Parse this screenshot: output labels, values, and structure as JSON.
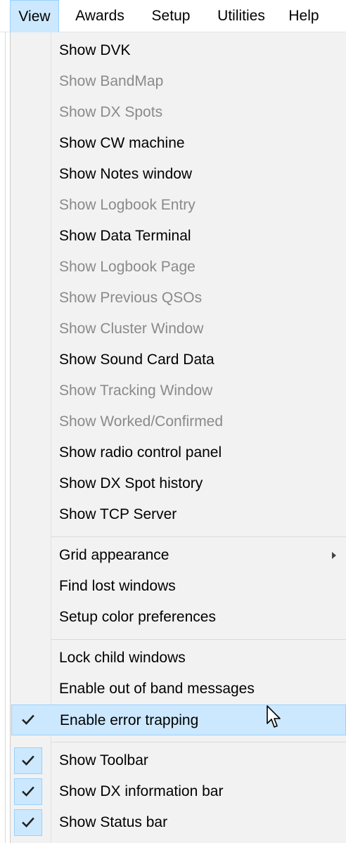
{
  "menubar": {
    "items": [
      {
        "label": "View",
        "active": true
      },
      {
        "label": "Awards",
        "active": false
      },
      {
        "label": "Setup",
        "active": false
      },
      {
        "label": "Utilities",
        "active": false
      },
      {
        "label": "Help",
        "active": false
      }
    ]
  },
  "view_menu": {
    "items": [
      {
        "label": "Show DVK",
        "enabled": true,
        "checked": false
      },
      {
        "label": "Show BandMap",
        "enabled": false,
        "checked": false
      },
      {
        "label": "Show DX Spots",
        "enabled": false,
        "checked": false
      },
      {
        "label": "Show CW machine",
        "enabled": true,
        "checked": false
      },
      {
        "label": "Show Notes window",
        "enabled": true,
        "checked": false
      },
      {
        "label": "Show Logbook Entry",
        "enabled": false,
        "checked": false
      },
      {
        "label": "Show Data Terminal",
        "enabled": true,
        "checked": false
      },
      {
        "label": "Show Logbook Page",
        "enabled": false,
        "checked": false
      },
      {
        "label": "Show Previous QSOs",
        "enabled": false,
        "checked": false
      },
      {
        "label": "Show Cluster Window",
        "enabled": false,
        "checked": false
      },
      {
        "label": "Show Sound Card Data",
        "enabled": true,
        "checked": false
      },
      {
        "label": "Show Tracking Window",
        "enabled": false,
        "checked": false
      },
      {
        "label": "Show Worked/Confirmed",
        "enabled": false,
        "checked": false
      },
      {
        "label": "Show radio control panel",
        "enabled": true,
        "checked": false
      },
      {
        "label": "Show DX Spot history",
        "enabled": true,
        "checked": false
      },
      {
        "label": "Show TCP Server",
        "enabled": true,
        "checked": false
      },
      {
        "separator": true
      },
      {
        "label": "Grid appearance",
        "enabled": true,
        "checked": false,
        "submenu": true
      },
      {
        "label": "Find lost windows",
        "enabled": true,
        "checked": false
      },
      {
        "label": "Setup color preferences",
        "enabled": true,
        "checked": false
      },
      {
        "separator": true
      },
      {
        "label": "Lock child windows",
        "enabled": true,
        "checked": false
      },
      {
        "label": "Enable out of band messages",
        "enabled": true,
        "checked": false
      },
      {
        "label": "Enable error trapping",
        "enabled": true,
        "checked": true,
        "hovered": true
      },
      {
        "separator": true
      },
      {
        "label": "Show Toolbar",
        "enabled": true,
        "checked": true
      },
      {
        "label": "Show DX information bar",
        "enabled": true,
        "checked": true
      },
      {
        "label": "Show Status bar",
        "enabled": true,
        "checked": true
      }
    ]
  },
  "colors": {
    "highlight": "#cce8ff",
    "highlight_border": "#99d1ff",
    "disabled_text": "#8a8a8a",
    "menu_background": "#f2f2f2"
  },
  "icons": {
    "check": "check-icon",
    "submenu": "chevron-right-icon",
    "pointer": "mouse-pointer-icon"
  }
}
